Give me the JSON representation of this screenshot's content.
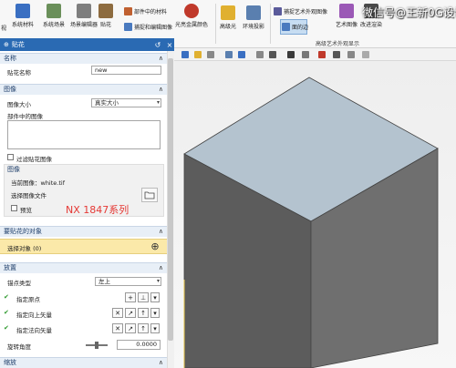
{
  "ribbon": {
    "left_cut_label": "视",
    "items": [
      {
        "label": "系统材料",
        "color": "#3a6fc2"
      },
      {
        "label": "系统场景",
        "color": "#6a8f5a"
      },
      {
        "label": "场景编辑器",
        "color": "#7e7e7e"
      },
      {
        "label": "贴花",
        "color": "#8d6b3f"
      },
      {
        "label": "光亮金属颜色",
        "color": "#c0392b"
      },
      {
        "label": "高级光",
        "color": "#e0b030"
      },
      {
        "label": "环境投影",
        "color": "#5a7faf"
      },
      {
        "label": "艺术图像",
        "color": "#9b59b6"
      },
      {
        "label": "改进渲染",
        "color": "#4a4a4a"
      }
    ],
    "small_items": [
      {
        "label": "部件中的材料",
        "color": "#c06030"
      },
      {
        "label": "捕捉和编辑图像",
        "color": "#4a7abf"
      },
      {
        "label": "捕捉艺术外观图像",
        "color": "#5a5a9a"
      },
      {
        "label": "面的边",
        "color": "#4a7abf"
      }
    ],
    "group_label": "高级艺术外观显示",
    "watermark": "微信号@王新0G设计"
  },
  "toolbar_icons": [
    "#3a6fc2",
    "#e0b030",
    "#888888",
    "#5a7faf",
    "#3a6fc2",
    "#888888",
    "#555555",
    "#3a3a3a",
    "#777777",
    "#c0392b",
    "#555555",
    "#888888",
    "#aaaaaa"
  ],
  "dialog": {
    "title": "贴花",
    "sections": {
      "name": {
        "header": "名称",
        "label": "贴花名称",
        "value": "new"
      },
      "image": {
        "header": "图像",
        "size_label": "图像大小",
        "size_value": "真实大小",
        "in_part_label": "部件中的图像",
        "filter_label": "过滤贴花图像",
        "sub_header": "图像",
        "current_image": "当前图像：white.tif",
        "select_file": "选择图像文件",
        "preview": "预览",
        "overlay_text": "NX 1847系列"
      },
      "target": {
        "header": "要贴花的对象",
        "select_label": "选择对象 (0)"
      },
      "placement": {
        "header": "放置",
        "anchor_label": "锚点类型",
        "anchor_value": "左上",
        "origin_label": "指定原点",
        "up_label": "指定向上矢量",
        "normal_label": "指定法向矢量",
        "rotation_label": "旋转角度",
        "rotation_value": "0.0000"
      },
      "scale": {
        "header": "缩放"
      }
    }
  }
}
